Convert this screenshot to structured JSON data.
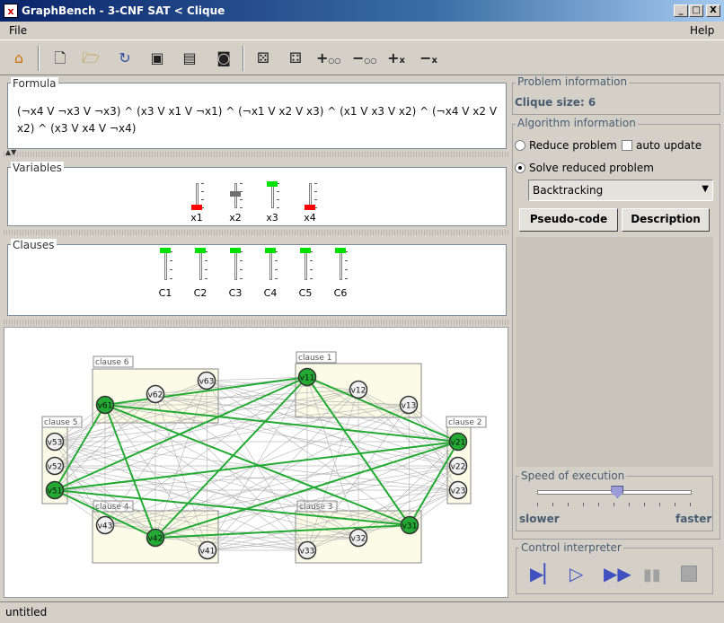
{
  "window": {
    "title": "GraphBench - 3-CNF SAT < Clique",
    "app_icon": "xj-app-icon",
    "controls": [
      "_",
      "□",
      "X"
    ]
  },
  "menu": {
    "file": "File",
    "help": "Help"
  },
  "toolbar": {
    "icons": [
      "home-icon",
      "new-file-icon",
      "open-folder-icon",
      "reload-icon",
      "save-icon",
      "save-as-icon",
      "camera-icon",
      "random-die-icon",
      "random-die-multi-icon",
      "add-vertex-icon",
      "remove-vertex-icon",
      "add-edge-icon",
      "remove-edge-icon"
    ],
    "glyphs": {
      "oo": "○○",
      "x": "x"
    }
  },
  "formula": {
    "title": "Formula",
    "text": "(¬x4 V ¬x3 V ¬x3) ^ (x3 V x1 V ¬x1) ^ (¬x1 V x2 V x3) ^ (x1 V x3 V x2) ^ (¬x4 V x2 V x2) ^ (x3 V x4 V ¬x4)"
  },
  "variables": {
    "title": "Variables",
    "items": [
      {
        "label": "x1",
        "state": "false",
        "color": "#ff0000"
      },
      {
        "label": "x2",
        "state": "unknown",
        "color": "#707070"
      },
      {
        "label": "x3",
        "state": "true",
        "color": "#00e000"
      },
      {
        "label": "x4",
        "state": "false",
        "color": "#ff0000"
      }
    ]
  },
  "clauses": {
    "title": "Clauses",
    "items": [
      {
        "label": "C1",
        "state": "true"
      },
      {
        "label": "C2",
        "state": "true"
      },
      {
        "label": "C3",
        "state": "true"
      },
      {
        "label": "C4",
        "state": "true"
      },
      {
        "label": "C5",
        "state": "true"
      },
      {
        "label": "C6",
        "state": "true"
      }
    ],
    "color": "#00e000"
  },
  "graph": {
    "clause_boxes": [
      "clause 1",
      "clause 2",
      "clause 3",
      "clause 4",
      "clause 5",
      "clause 6"
    ],
    "vertices": {
      "v11": {
        "label": "v11",
        "selected": true
      },
      "v12": {
        "label": "v12",
        "selected": false
      },
      "v13": {
        "label": "v13",
        "selected": false
      },
      "v21": {
        "label": "v21",
        "selected": true
      },
      "v22": {
        "label": "v22",
        "selected": false
      },
      "v23": {
        "label": "v23",
        "selected": false
      },
      "v31": {
        "label": "v31",
        "selected": true
      },
      "v32": {
        "label": "v32",
        "selected": false
      },
      "v33": {
        "label": "v33",
        "selected": false
      },
      "v41": {
        "label": "v41",
        "selected": false
      },
      "v42": {
        "label": "v42",
        "selected": true
      },
      "v43": {
        "label": "v43",
        "selected": false
      },
      "v51": {
        "label": "v51",
        "selected": true
      },
      "v52": {
        "label": "v52",
        "selected": false
      },
      "v53": {
        "label": "v53",
        "selected": false
      },
      "v61": {
        "label": "v61",
        "selected": true
      },
      "v62": {
        "label": "v62",
        "selected": false
      },
      "v63": {
        "label": "v63",
        "selected": false
      }
    },
    "selected_color": "#22aa33",
    "edge_color": "#a8a8a8",
    "clique_edge_color": "#22aa33"
  },
  "problem_info": {
    "title": "Problem information",
    "clique_size": "Clique size: 6"
  },
  "algorithm_info": {
    "title": "Algorithm information",
    "reduce_label": "Reduce problem",
    "auto_update_label": "auto update",
    "solve_label": "Solve reduced problem",
    "selected_mode": "solve",
    "algorithm": "Backtracking",
    "pseudo_code_button": "Pseudo-code",
    "description_button": "Description"
  },
  "speed": {
    "title": "Speed of execution",
    "slower": "slower",
    "faster": "faster",
    "level": 0.52
  },
  "control": {
    "title": "Control interpreter",
    "buttons": [
      "step-icon",
      "play-icon",
      "fast-forward-icon",
      "pause-icon",
      "stop-icon"
    ]
  },
  "status": {
    "text": "untitled"
  }
}
